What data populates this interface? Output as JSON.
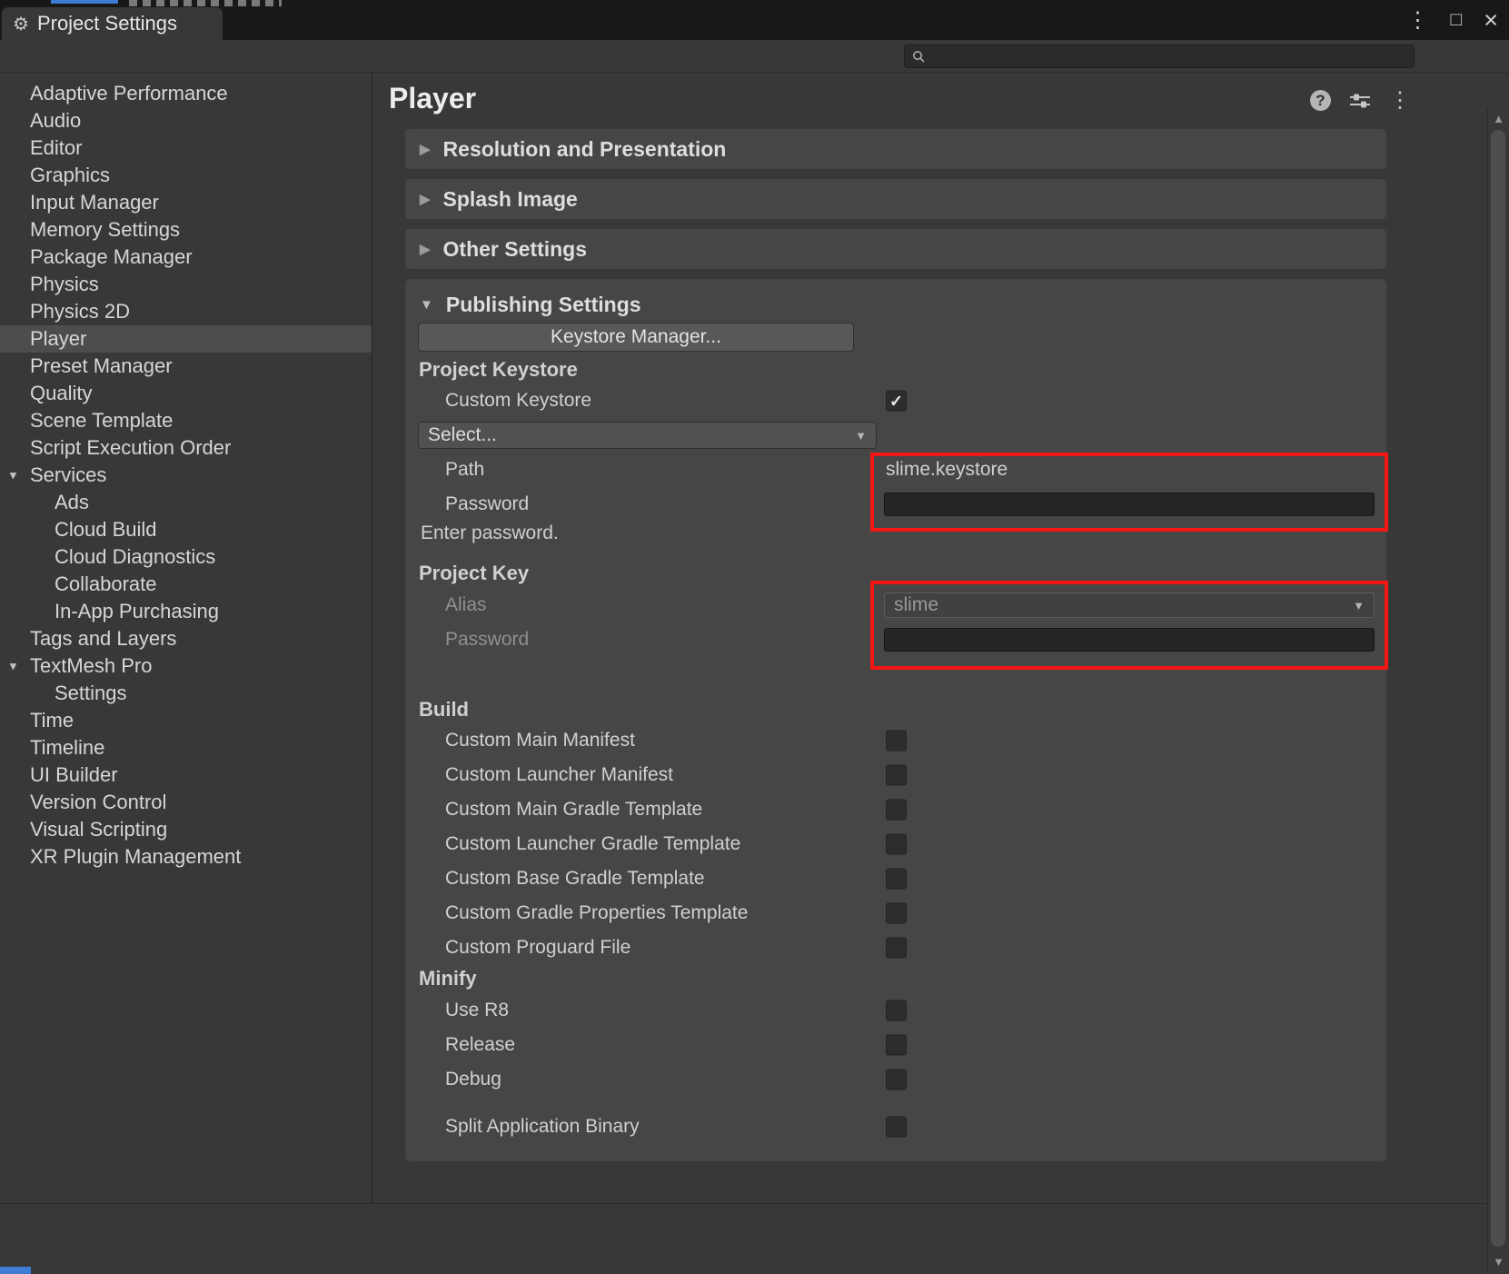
{
  "window": {
    "tab_title": "Project Settings"
  },
  "icons": {
    "gear": "⚙",
    "kebab": "⋮",
    "maximize": "□",
    "close": "×",
    "help": "?",
    "foldout_open": "▼",
    "foldout_closed": "▶",
    "dropdown_arrow": "▼",
    "check": "✓",
    "scroll_up": "▲",
    "scroll_down": "▼"
  },
  "search": {
    "placeholder": ""
  },
  "sidebar": {
    "items": [
      {
        "label": "Adaptive Performance",
        "level": 1
      },
      {
        "label": "Audio",
        "level": 1
      },
      {
        "label": "Editor",
        "level": 1
      },
      {
        "label": "Graphics",
        "level": 1
      },
      {
        "label": "Input Manager",
        "level": 1
      },
      {
        "label": "Memory Settings",
        "level": 1
      },
      {
        "label": "Package Manager",
        "level": 1
      },
      {
        "label": "Physics",
        "level": 1
      },
      {
        "label": "Physics 2D",
        "level": 1
      },
      {
        "label": "Player",
        "level": 1,
        "selected": true
      },
      {
        "label": "Preset Manager",
        "level": 1
      },
      {
        "label": "Quality",
        "level": 1
      },
      {
        "label": "Scene Template",
        "level": 1
      },
      {
        "label": "Script Execution Order",
        "level": 1
      },
      {
        "label": "Services",
        "level": 1,
        "expanded": true
      },
      {
        "label": "Ads",
        "level": 2
      },
      {
        "label": "Cloud Build",
        "level": 2
      },
      {
        "label": "Cloud Diagnostics",
        "level": 2
      },
      {
        "label": "Collaborate",
        "level": 2
      },
      {
        "label": "In-App Purchasing",
        "level": 2
      },
      {
        "label": "Tags and Layers",
        "level": 1
      },
      {
        "label": "TextMesh Pro",
        "level": 1,
        "expanded": true
      },
      {
        "label": "Settings",
        "level": 2
      },
      {
        "label": "Time",
        "level": 1
      },
      {
        "label": "Timeline",
        "level": 1
      },
      {
        "label": "UI Builder",
        "level": 1
      },
      {
        "label": "Version Control",
        "level": 1
      },
      {
        "label": "Visual Scripting",
        "level": 1
      },
      {
        "label": "XR Plugin Management",
        "level": 1
      }
    ]
  },
  "main": {
    "title": "Player",
    "sections": [
      {
        "label": "Resolution and Presentation",
        "expanded": false
      },
      {
        "label": "Splash Image",
        "expanded": false
      },
      {
        "label": "Other Settings",
        "expanded": false
      }
    ],
    "publishing": {
      "label": "Publishing Settings",
      "expanded": true,
      "keystore_manager_button": "Keystore Manager...",
      "project_keystore": {
        "label": "Project Keystore",
        "custom_keystore_label": "Custom Keystore",
        "custom_keystore_checked": true,
        "select_label": "Select...",
        "path_label": "Path",
        "path_value": "slime.keystore",
        "password_label": "Password",
        "password_value": "",
        "hint": "Enter password."
      },
      "project_key": {
        "label": "Project Key",
        "alias_label": "Alias",
        "alias_value": "slime",
        "password_label": "Password",
        "password_value": ""
      },
      "build": {
        "label": "Build",
        "options": [
          "Custom Main Manifest",
          "Custom Launcher Manifest",
          "Custom Main Gradle Template",
          "Custom Launcher Gradle Template",
          "Custom Base Gradle Template",
          "Custom Gradle Properties Template",
          "Custom Proguard File"
        ],
        "checked": [
          false,
          false,
          false,
          false,
          false,
          false,
          false
        ]
      },
      "minify": {
        "label": "Minify",
        "options": [
          "Use R8",
          "Release",
          "Debug"
        ],
        "checked": [
          false,
          false,
          false
        ]
      },
      "split_application_binary": {
        "label": "Split Application Binary",
        "checked": false
      }
    }
  },
  "colors": {
    "highlight_box": "#f51616",
    "panel": "#464646",
    "background": "#383838",
    "selected_row": "#4d4d4d",
    "accent_blue": "#3d7dd6"
  }
}
